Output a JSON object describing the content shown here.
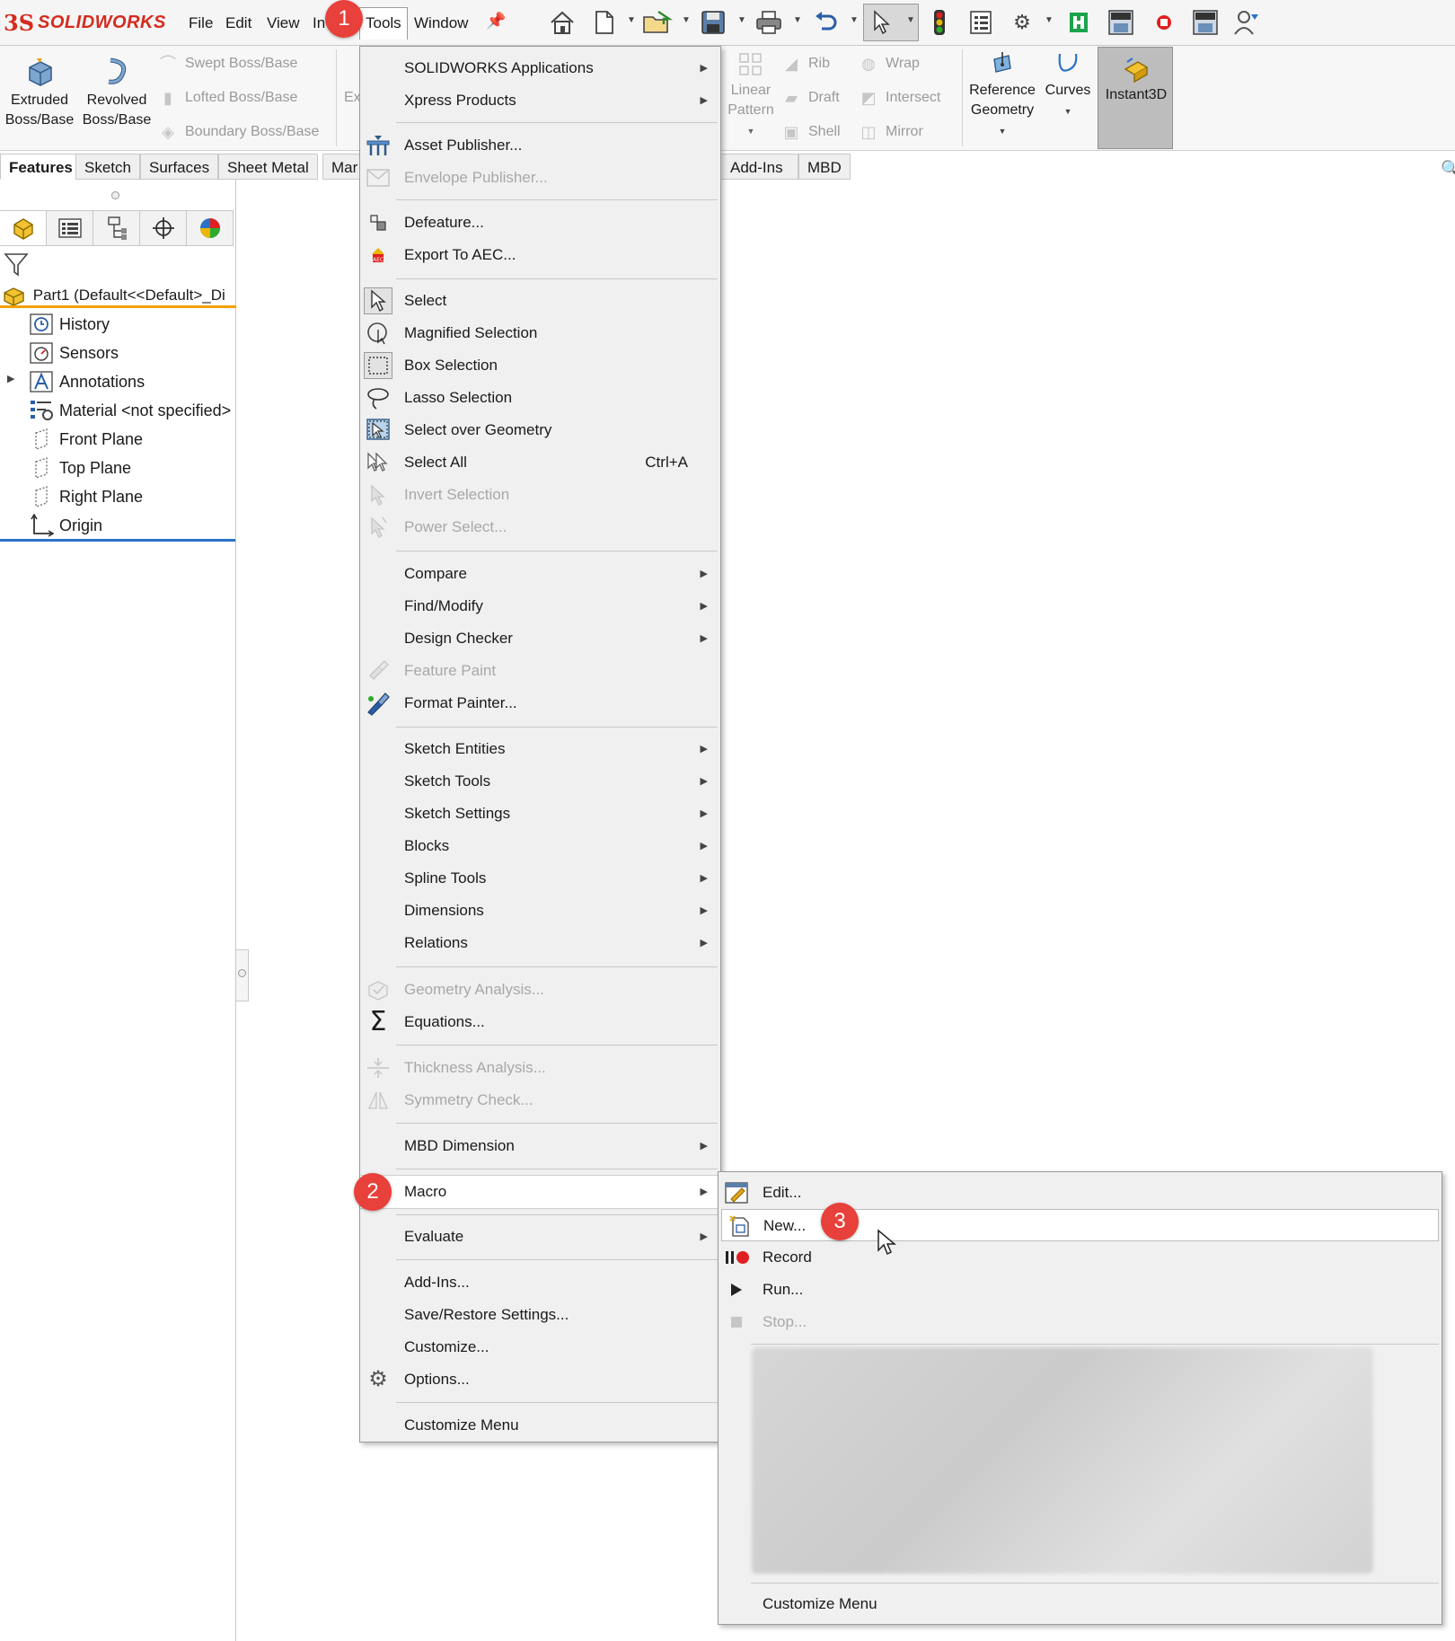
{
  "app": {
    "brand_mark": "3S",
    "brand_name": "SOLIDWORKS"
  },
  "menubar": {
    "items": [
      "File",
      "Edit",
      "View",
      "In",
      "Tools",
      "Window"
    ]
  },
  "command_manager": {
    "extruded": "Extruded Boss/Base",
    "revolved": "Revolved Boss/Base",
    "swept": "Swept Boss/Base",
    "lofted": "Lofted Boss/Base",
    "boundary": "Boundary Boss/Base",
    "ex_partial": "Ex",
    "linear_pattern": "Linear Pattern",
    "rib": "Rib",
    "draft": "Draft",
    "shell": "Shell",
    "wrap": "Wrap",
    "intersect": "Intersect",
    "mirror": "Mirror",
    "reference_geometry": "Reference Geometry",
    "curves": "Curves",
    "instant3d": "Instant3D"
  },
  "tabs": [
    "Features",
    "Sketch",
    "Surfaces",
    "Sheet Metal",
    "Mar",
    "Add-Ins",
    "MBD"
  ],
  "feature_tree": {
    "root": "Part1  (Default<<Default>_Di",
    "items": [
      "History",
      "Sensors",
      "Annotations",
      "Material <not specified>",
      "Front Plane",
      "Top Plane",
      "Right Plane",
      "Origin"
    ]
  },
  "tools_menu": {
    "items": [
      {
        "label": "SOLIDWORKS Applications",
        "submenu": true
      },
      {
        "label": "Xpress Products",
        "submenu": true
      },
      {
        "label": "Asset Publisher..."
      },
      {
        "label": "Envelope Publisher...",
        "disabled": true
      },
      {
        "label": "Defeature..."
      },
      {
        "label": "Export To AEC..."
      },
      {
        "label": "Select"
      },
      {
        "label": "Magnified Selection"
      },
      {
        "label": "Box Selection"
      },
      {
        "label": "Lasso Selection"
      },
      {
        "label": "Select over Geometry"
      },
      {
        "label": "Select All",
        "shortcut": "Ctrl+A"
      },
      {
        "label": "Invert Selection",
        "disabled": true
      },
      {
        "label": "Power Select...",
        "disabled": true
      },
      {
        "label": "Compare",
        "submenu": true
      },
      {
        "label": "Find/Modify",
        "submenu": true
      },
      {
        "label": "Design Checker",
        "submenu": true
      },
      {
        "label": "Feature Paint",
        "disabled": true
      },
      {
        "label": "Format Painter..."
      },
      {
        "label": "Sketch Entities",
        "submenu": true
      },
      {
        "label": "Sketch Tools",
        "submenu": true
      },
      {
        "label": "Sketch Settings",
        "submenu": true
      },
      {
        "label": "Blocks",
        "submenu": true
      },
      {
        "label": "Spline Tools",
        "submenu": true
      },
      {
        "label": "Dimensions",
        "submenu": true
      },
      {
        "label": "Relations",
        "submenu": true
      },
      {
        "label": "Geometry Analysis...",
        "disabled": true
      },
      {
        "label": "Equations..."
      },
      {
        "label": "Thickness Analysis...",
        "disabled": true
      },
      {
        "label": "Symmetry Check...",
        "disabled": true
      },
      {
        "label": "MBD Dimension",
        "submenu": true
      },
      {
        "label": "Macro",
        "submenu": true
      },
      {
        "label": "Evaluate",
        "submenu": true
      },
      {
        "label": "Add-Ins..."
      },
      {
        "label": "Save/Restore Settings..."
      },
      {
        "label": "Customize..."
      },
      {
        "label": "Options..."
      },
      {
        "label": "Customize Menu"
      }
    ]
  },
  "macro_menu": {
    "items": [
      {
        "label": "Edit..."
      },
      {
        "label": "New..."
      },
      {
        "label": "Record"
      },
      {
        "label": "Run..."
      },
      {
        "label": "Stop...",
        "disabled": true
      },
      {
        "label": "Customize Menu"
      }
    ]
  },
  "steps": [
    "1",
    "2",
    "3"
  ],
  "colors": {
    "brand": "#d52b1e",
    "badge": "#e8403a",
    "menu_bg": "#f0f0f0",
    "tree_root_underline": "#f2a100",
    "tree_end_line": "#2a72c8",
    "record_dot": "#e02020"
  }
}
